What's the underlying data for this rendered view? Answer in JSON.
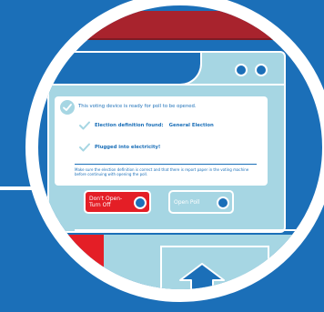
{
  "colors": {
    "primary_blue": "#1b6fb8",
    "light_blue": "#a6d6e3",
    "accent_red": "#e41e26",
    "dark_red": "#a8232d",
    "white": "#ffffff"
  },
  "icons": {
    "panel_status": "check-circle-icon",
    "item_check": "check-icon",
    "arrow": "arrow-up-icon",
    "toggle": "toggle-circle-icon"
  },
  "dialog": {
    "title": "This voting device is ready for poll to be opened.",
    "items": [
      {
        "label": "Election definition found:",
        "value": "General Election"
      },
      {
        "label": "Plugged into electricity!",
        "value": ""
      }
    ],
    "note": "Make sure the election definition is correct and that there is report paper in the voting machine before continuing with opening the poll."
  },
  "buttons": {
    "dont_open": "Don't Open-Turn Off",
    "open_poll": "Open Poll"
  }
}
